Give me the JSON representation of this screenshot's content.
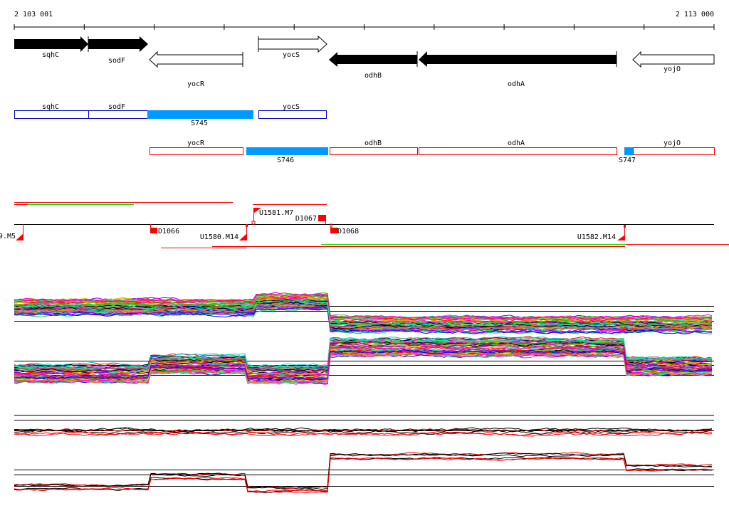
{
  "scale": {
    "start_label": "2 103 001",
    "end_label": "2 113 000"
  },
  "genes": {
    "sqhC": "sqhC",
    "sodF": "sodF",
    "yocR": "yocR",
    "yocS": "yocS",
    "odhB": "odhB",
    "odhA": "odhA",
    "yojO": "yojO"
  },
  "operons_blue": {
    "sqhC": "sqhC",
    "sodF": "sodF",
    "S745": "S745",
    "yocS": "yocS"
  },
  "operons_red": {
    "yocR": "yocR",
    "S746": "S746",
    "odhB": "odhB",
    "odhA": "odhA",
    "S747": "S747",
    "yojO": "yojO"
  },
  "markers": {
    "m1": "9.M5",
    "m2": "D1066",
    "m3": "U1580.M14",
    "m4": "U1581.M7",
    "m5": "D1067",
    "m6": "D1068",
    "m7": "U1582.M14"
  },
  "colors": {
    "blue_fill": "#0099ff",
    "blue_outline": "#0000cc",
    "red": "#ff0000",
    "green": "#00dd00"
  }
}
